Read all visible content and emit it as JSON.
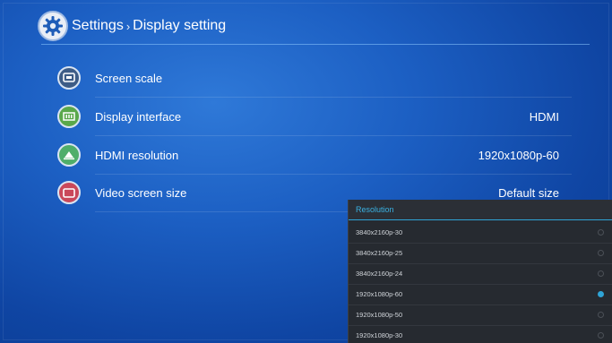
{
  "header": {
    "title": "Settings",
    "separator": "›",
    "subtitle": "Display setting"
  },
  "items": [
    {
      "label": "Screen scale",
      "value": "",
      "icon": "screen-scale-icon"
    },
    {
      "label": "Display interface",
      "value": "HDMI",
      "icon": "display-interface-icon"
    },
    {
      "label": "HDMI resolution",
      "value": "1920x1080p-60",
      "icon": "hdmi-icon"
    },
    {
      "label": "Video screen size",
      "value": "Default size",
      "icon": "screen-size-icon"
    }
  ],
  "dropdown": {
    "title": "Resolution",
    "options": [
      {
        "label": "3840x2160p-30",
        "selected": false
      },
      {
        "label": "3840x2160p-25",
        "selected": false
      },
      {
        "label": "3840x2160p-24",
        "selected": false
      },
      {
        "label": "1920x1080p-60",
        "selected": true
      },
      {
        "label": "1920x1080p-50",
        "selected": false
      },
      {
        "label": "1920x1080p-30",
        "selected": false
      }
    ]
  },
  "colors": {
    "accent": "#2fa4d6",
    "background": "#1c5fc3"
  }
}
